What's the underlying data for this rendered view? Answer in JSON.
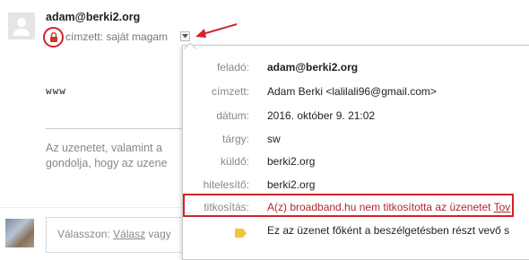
{
  "message": {
    "sender": "adam@berki2.org",
    "to_line": "címzett: saját magam",
    "subject_body": "www",
    "body_preview": [
      "Az uzenetet, valamint a",
      "gondolja, hogy az uzene"
    ]
  },
  "reply": {
    "prefix": "Válasszon: ",
    "reply_link": "Válasz",
    "suffix": " vagy"
  },
  "details": {
    "rows": [
      {
        "label": "feladó:",
        "value": "adam@berki2.org"
      },
      {
        "label": "címzett:",
        "value": "Adam Berki <lalilali96@gmail.com>"
      },
      {
        "label": "dátum:",
        "value": "2016. október 9. 21:02"
      },
      {
        "label": "tárgy:",
        "value": "sw"
      },
      {
        "label": "küldő:",
        "value": "berki2.org"
      },
      {
        "label": "hitelesítő:",
        "value": "berki2.org"
      }
    ],
    "encryption": {
      "label": "titkosítás:",
      "value": "A(z) broadband.hu nem titkosította az üzenetet",
      "link": "Tov"
    },
    "importance": "Ez az üzenet főként a beszélgetésben részt vevő s"
  },
  "colors": {
    "highlight": "#d2232a",
    "encryption_text": "#b3262a",
    "tag": "#f3c33a"
  },
  "icons": {
    "lock": "lock-icon",
    "avatar": "person-icon",
    "tag": "importance-tag-icon",
    "caret": "chevron-down-icon",
    "arrow": "annotation-arrow"
  }
}
